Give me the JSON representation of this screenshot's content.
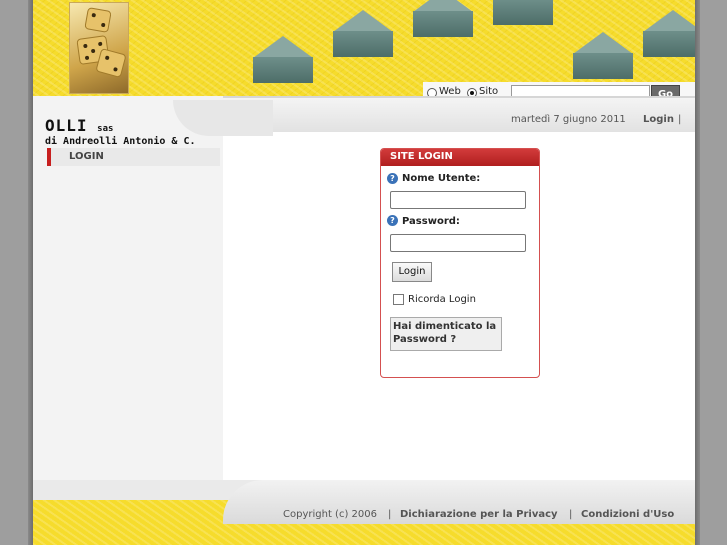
{
  "search": {
    "web_label": "Web",
    "site_label": "Sito",
    "selected": "Sito",
    "input_value": "",
    "go_label": "Go"
  },
  "brand": {
    "name": "OLLI",
    "suffix": "sas",
    "subtitle": "di Andreolli Antonio & C."
  },
  "nav": {
    "items": [
      {
        "label": "LOGIN"
      }
    ]
  },
  "topbar": {
    "date": "martedì 7 giugno 2011",
    "login_link": "Login",
    "separator": "|"
  },
  "login_box": {
    "title": "SITE LOGIN",
    "username_label": "Nome Utente:",
    "username_value": "",
    "password_label": "Password:",
    "password_value": "",
    "login_button": "Login",
    "remember_label": "Ricorda Login",
    "remember_checked": false,
    "forgot_label": "Hai dimenticato la Password ?"
  },
  "footer": {
    "copyright": "Copyright (c) 2006",
    "sep1": "|",
    "privacy": "Dichiarazione per la Privacy",
    "sep2": "|",
    "terms": "Condizioni d'Uso"
  },
  "colors": {
    "header_yellow": "#f6dc2c",
    "accent_red": "#c71f1f",
    "background_gray": "#9e9e9e"
  },
  "icons": {
    "help": "question-circle-icon",
    "header_image": "dice-icon"
  }
}
